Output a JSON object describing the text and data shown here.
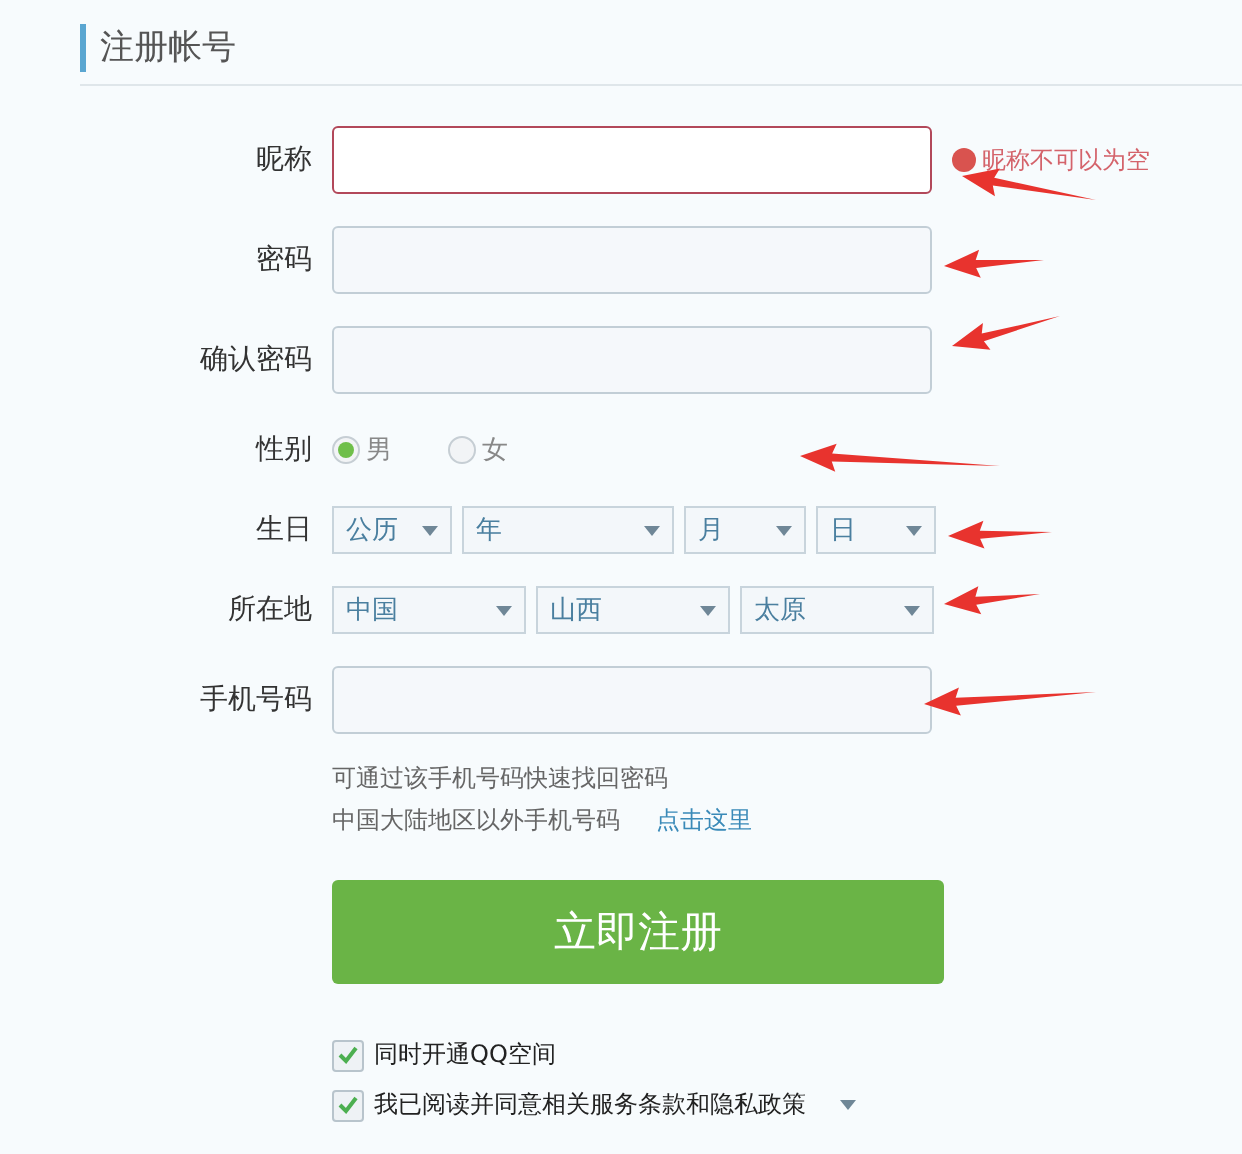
{
  "title": "注册帐号",
  "fields": [
    {
      "kind": "text",
      "label": "昵称",
      "error": "昵称不可以为空"
    },
    {
      "kind": "text",
      "label": "密码"
    },
    {
      "kind": "text",
      "label": "确认密码"
    },
    {
      "kind": "radio",
      "label": "性别",
      "options": [
        {
          "label": "男",
          "selected": true
        },
        {
          "label": "女",
          "selected": false
        }
      ]
    },
    {
      "kind": "select",
      "label": "生日",
      "selects": [
        "公历",
        "年",
        "月",
        "日"
      ]
    },
    {
      "kind": "select",
      "label": "所在地",
      "selects": [
        "中国",
        "山西",
        "太原"
      ]
    },
    {
      "kind": "text",
      "label": "手机号码"
    }
  ],
  "hints": [
    "可通过该手机号码快速找回密码",
    "中国大陆地区以外手机号码"
  ],
  "hint_link": "点击这里",
  "submit": "立即注册",
  "checkboxes": [
    {
      "label": "同时开通QQ空间",
      "checked": true,
      "dropdown": false
    },
    {
      "label": "我已阅读并同意相关服务条款和隐私政策",
      "checked": true,
      "dropdown": true
    }
  ]
}
